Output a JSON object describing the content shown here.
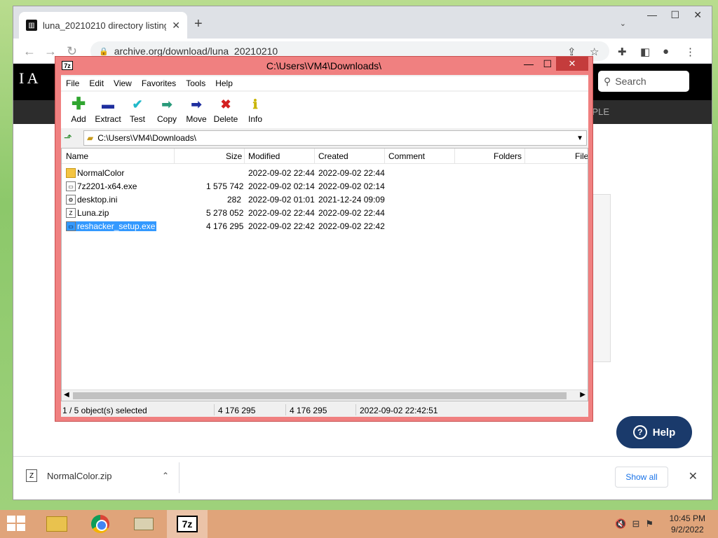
{
  "browser": {
    "tab_title": "luna_20210210 directory listing",
    "tab_close": "✕",
    "new_tab": "+",
    "url": "archive.org/download/luna_20210210"
  },
  "archive_page": {
    "logo_text": "I A",
    "search_placeholder": "Search",
    "subnav_text": "PLE",
    "help_label": "Help"
  },
  "downloads": {
    "file_name": "NormalColor.zip",
    "show_all": "Show all"
  },
  "sevenzip": {
    "title": "C:\\Users\\VM4\\Downloads\\",
    "menu": [
      "File",
      "Edit",
      "View",
      "Favorites",
      "Tools",
      "Help"
    ],
    "toolbar": [
      {
        "label": "Add",
        "icon": "add-icon",
        "color": "#2fa52f"
      },
      {
        "label": "Extract",
        "icon": "extract-icon",
        "color": "#1f2f9f"
      },
      {
        "label": "Test",
        "icon": "test-icon",
        "color": "#21b9c9"
      },
      {
        "label": "Copy",
        "icon": "copy-icon",
        "color": "#2a9a7a"
      },
      {
        "label": "Move",
        "icon": "move-icon",
        "color": "#1f2f9f"
      },
      {
        "label": "Delete",
        "icon": "delete-icon",
        "color": "#d32020"
      },
      {
        "label": "Info",
        "icon": "info-icon",
        "color": "#c9b400"
      }
    ],
    "address": "C:\\Users\\VM4\\Downloads\\",
    "columns": [
      "Name",
      "Size",
      "Modified",
      "Created",
      "Comment",
      "Folders",
      "File"
    ],
    "files": [
      {
        "name": "NormalColor",
        "size": "",
        "modified": "2022-09-02 22:44",
        "created": "2022-09-02 22:44",
        "type": "folder"
      },
      {
        "name": "7z2201-x64.exe",
        "size": "1 575 742",
        "modified": "2022-09-02 02:14",
        "created": "2022-09-02 02:14",
        "type": "exe"
      },
      {
        "name": "desktop.ini",
        "size": "282",
        "modified": "2022-09-02 01:01",
        "created": "2021-12-24 09:09",
        "type": "ini"
      },
      {
        "name": "Luna.zip",
        "size": "5 278 052",
        "modified": "2022-09-02 22:44",
        "created": "2022-09-02 22:44",
        "type": "zip"
      },
      {
        "name": "reshacker_setup.exe",
        "size": "4 176 295",
        "modified": "2022-09-02 22:42",
        "created": "2022-09-02 22:42",
        "type": "exe",
        "selected": true
      }
    ],
    "status": {
      "selection": "1 / 5 object(s) selected",
      "size1": "4 176 295",
      "size2": "4 176 295",
      "datetime": "2022-09-02 22:42:51"
    }
  },
  "taskbar": {
    "sevenzip_label": "7z",
    "time": "10:45 PM",
    "date": "9/2/2022"
  }
}
